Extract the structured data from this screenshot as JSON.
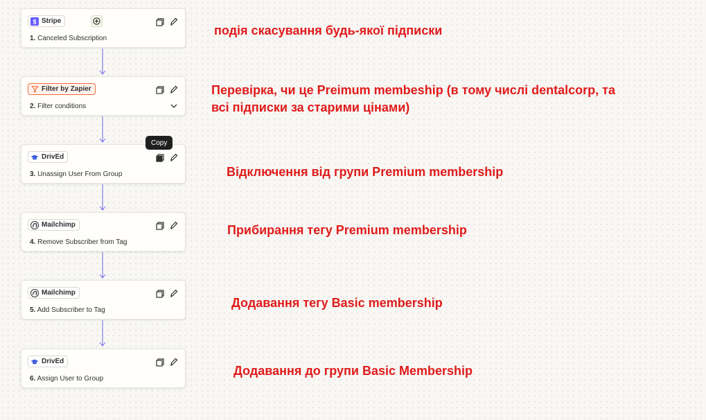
{
  "steps": [
    {
      "app": "Stripe",
      "number": "1.",
      "title": "Canceled Subscription",
      "has_trigger_badge": true
    },
    {
      "app": "Filter by Zapier",
      "number": "2.",
      "title": "Filter conditions",
      "has_chevron": true
    },
    {
      "app": "DrivEd",
      "number": "3.",
      "title": "Unassign User From Group"
    },
    {
      "app": "Mailchimp",
      "number": "4.",
      "title": "Remove Subscriber from Tag"
    },
    {
      "app": "Mailchimp",
      "number": "5.",
      "title": "Add Subscriber to Tag"
    },
    {
      "app": "DrivEd",
      "number": "6.",
      "title": "Assign User to Group"
    }
  ],
  "tooltip": "Copy",
  "notes": {
    "n1": "подія скасування будь-якої підписки",
    "n2_line1": "Перевірка, чи це Preimum membeship (в тому числі dentalcorp, та",
    "n2_line2": "всі підписки за старими цінами)",
    "n3": "Відключення від групи Premium membership",
    "n4": "Прибирання тегу Premium membership",
    "n5": "Додавання тегу Basic membership",
    "n6": "Додавання до групи Basic Membership"
  },
  "colors": {
    "connector": "#6b64e8",
    "annotation": "#e01b1b",
    "stripe": "#635bff",
    "filter": "#f26b3a",
    "drived": "#3b5bdb"
  },
  "icons": {
    "copy": "duplicate-icon",
    "edit": "pencil-icon",
    "expand": "chevron-down-icon",
    "trigger": "plus-circle-icon"
  }
}
